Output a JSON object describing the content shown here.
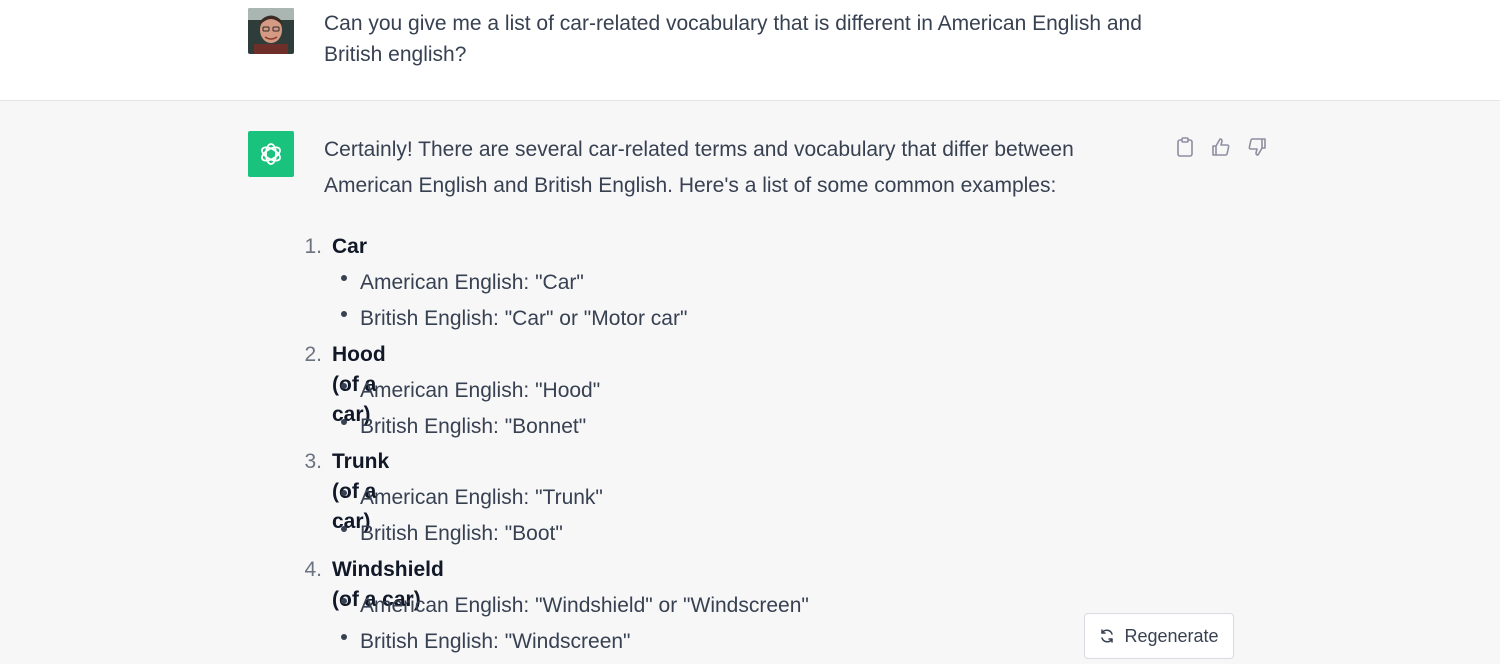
{
  "user_message": {
    "avatar_icon": "user-photo-avatar",
    "text": "Can you give me a list of car-related vocabulary that is different in American English and British english?"
  },
  "assistant_message": {
    "avatar_icon": "openai-logo",
    "intro": "Certainly! There are several car-related terms and vocabulary that differ between American English and British English. Here's a list of some common examples:",
    "actions": [
      "clipboard-icon",
      "thumbs-up-icon",
      "thumbs-down-icon"
    ],
    "items": [
      {
        "number": "1.",
        "term": "Car",
        "american": "American English: \"Car\"",
        "british": "British English: \"Car\" or \"Motor car\""
      },
      {
        "number": "2.",
        "term": "Hood (of a car)",
        "american": "American English: \"Hood\"",
        "british": "British English: \"Bonnet\""
      },
      {
        "number": "3.",
        "term": "Trunk (of a car)",
        "american": "American English: \"Trunk\"",
        "british": "British English: \"Boot\""
      },
      {
        "number": "4.",
        "term": "Windshield (of a car)",
        "american": "American English: \"Windshield\" or \"Windscreen\"",
        "british": "British English: \"Windscreen\""
      }
    ]
  },
  "regenerate": {
    "label": "Regenerate",
    "icon": "refresh-icon"
  },
  "colors": {
    "accent": "#19c37d",
    "user_bg": "#ffffff",
    "assistant_bg": "#f7f7f8"
  }
}
